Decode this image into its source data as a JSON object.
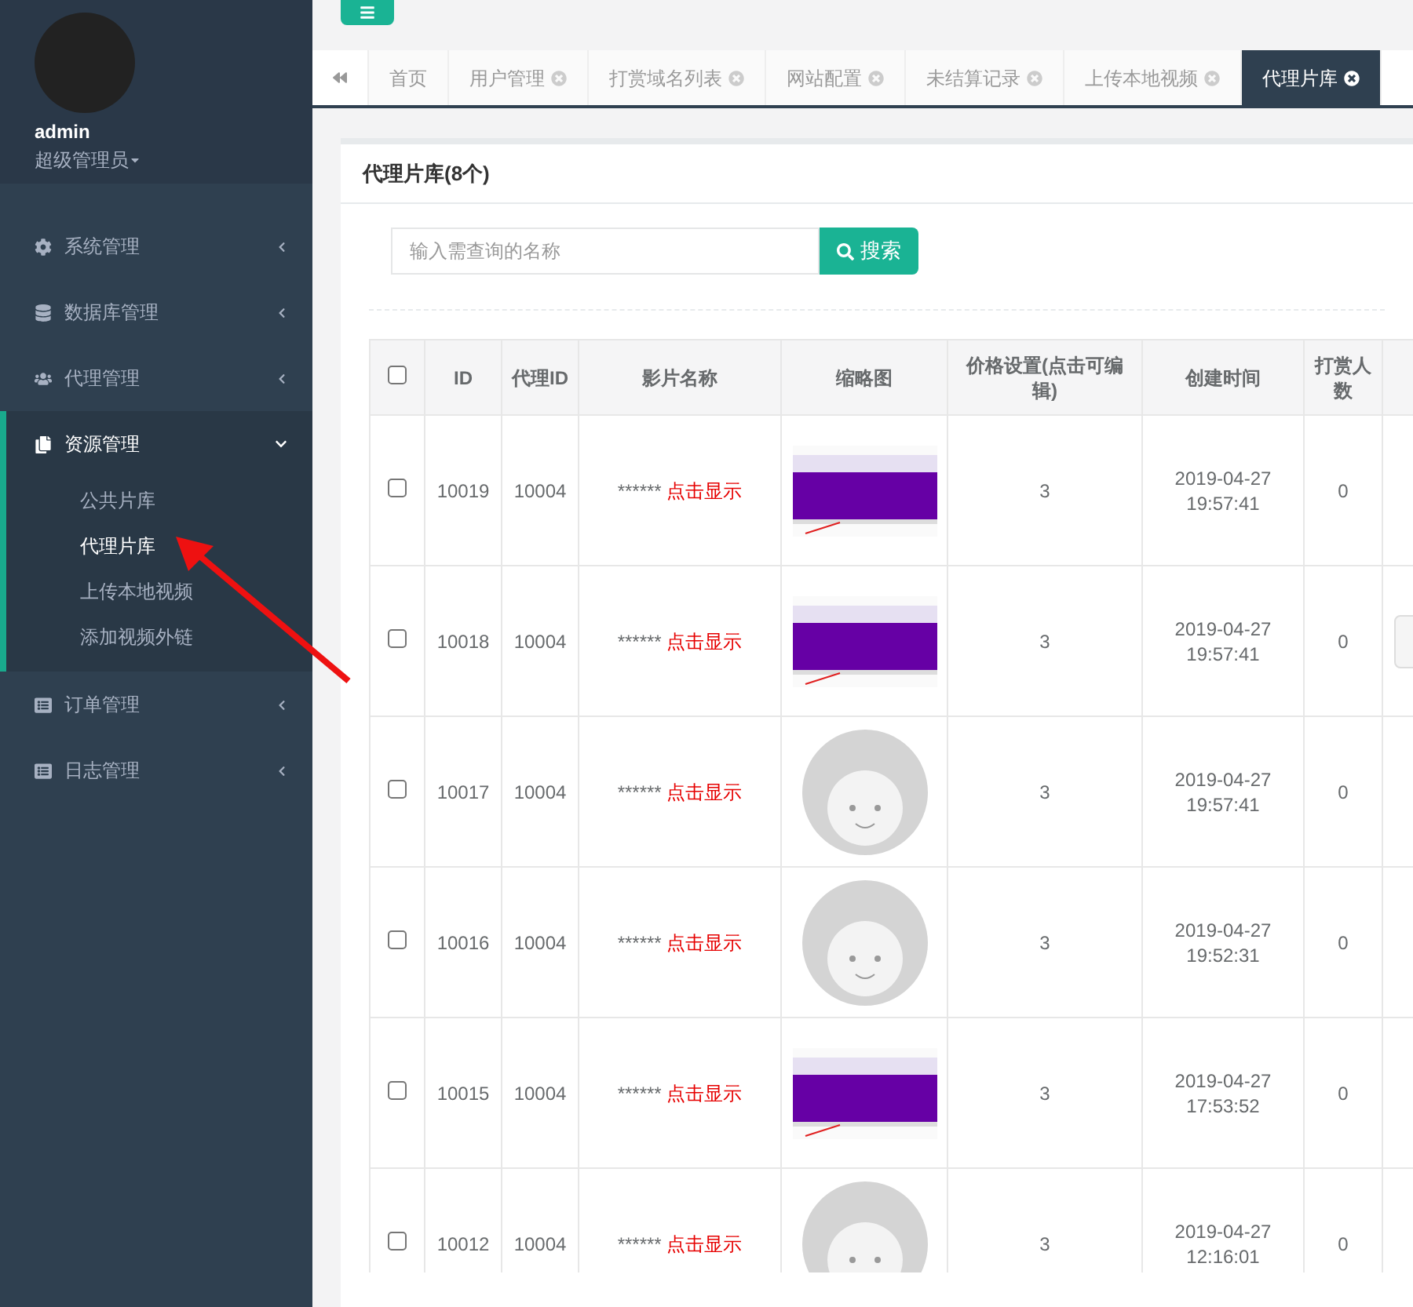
{
  "user": {
    "name": "admin",
    "role": "超级管理员"
  },
  "sidebar": {
    "items": [
      {
        "label": "系统管理",
        "expanded": false
      },
      {
        "label": "数据库管理",
        "expanded": false
      },
      {
        "label": "代理管理",
        "expanded": false
      },
      {
        "label": "资源管理",
        "expanded": true,
        "children": [
          {
            "label": "公共片库",
            "selected": false
          },
          {
            "label": "代理片库",
            "selected": true
          },
          {
            "label": "上传本地视频",
            "selected": false
          },
          {
            "label": "添加视频外链",
            "selected": false
          }
        ]
      },
      {
        "label": "订单管理",
        "expanded": false
      },
      {
        "label": "日志管理",
        "expanded": false
      }
    ]
  },
  "tabs": [
    {
      "label": "首页",
      "closable": false,
      "selected": false
    },
    {
      "label": "用户管理",
      "closable": true,
      "selected": false
    },
    {
      "label": "打赏域名列表",
      "closable": true,
      "selected": false
    },
    {
      "label": "网站配置",
      "closable": true,
      "selected": false
    },
    {
      "label": "未结算记录",
      "closable": true,
      "selected": false
    },
    {
      "label": "上传本地视频",
      "closable": true,
      "selected": false
    },
    {
      "label": "代理片库",
      "closable": true,
      "selected": true
    }
  ],
  "panel": {
    "title": "代理片库(8个)",
    "search": {
      "placeholder": "输入需查询的名称",
      "button": "搜索"
    }
  },
  "table": {
    "select_all_checked": false,
    "columns": [
      "ID",
      "代理ID",
      "影片名称",
      "缩略图",
      "价格设置(点击可编辑)",
      "创建时间",
      "打赏人数"
    ],
    "rows": [
      {
        "checked": false,
        "id": "10019",
        "agent_id": "10004",
        "masked": "******",
        "link": "点击显示",
        "kind": "screenshot",
        "price": "3",
        "date": "2019-04-27",
        "time": "19:57:41",
        "count": "0",
        "action_button": false
      },
      {
        "checked": false,
        "id": "10018",
        "agent_id": "10004",
        "masked": "******",
        "link": "点击显示",
        "kind": "screenshot",
        "price": "3",
        "date": "2019-04-27",
        "time": "19:57:41",
        "count": "0",
        "action_button": true
      },
      {
        "checked": false,
        "id": "10017",
        "agent_id": "10004",
        "masked": "******",
        "link": "点击显示",
        "kind": "placeholder",
        "price": "3",
        "date": "2019-04-27",
        "time": "19:57:41",
        "count": "0",
        "action_button": false
      },
      {
        "checked": false,
        "id": "10016",
        "agent_id": "10004",
        "masked": "******",
        "link": "点击显示",
        "kind": "placeholder",
        "price": "3",
        "date": "2019-04-27",
        "time": "19:52:31",
        "count": "0",
        "action_button": false
      },
      {
        "checked": false,
        "id": "10015",
        "agent_id": "10004",
        "masked": "******",
        "link": "点击显示",
        "kind": "screenshot",
        "price": "3",
        "date": "2019-04-27",
        "time": "17:53:52",
        "count": "0",
        "action_button": false
      },
      {
        "checked": false,
        "id": "10012",
        "agent_id": "10004",
        "masked": "******",
        "link": "点击显示",
        "kind": "placeholder",
        "price": "3",
        "date": "2019-04-27",
        "time": "12:16:01",
        "count": "0",
        "action_button": false
      }
    ]
  }
}
